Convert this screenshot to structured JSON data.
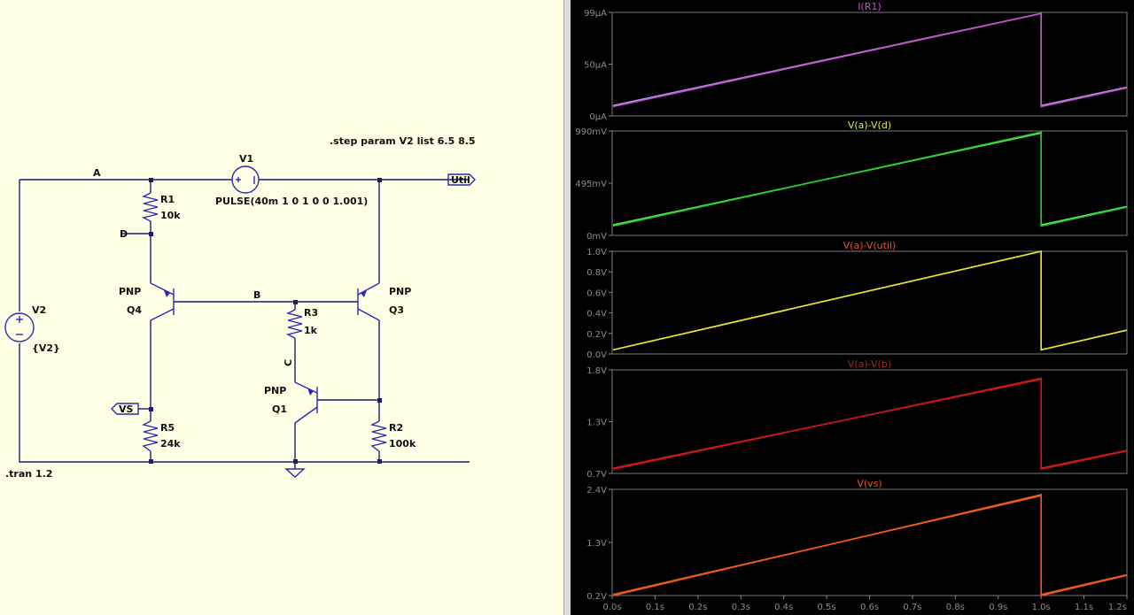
{
  "schematic": {
    "step_directive": ".step param V2 list 6.5 8.5",
    "tran_directive": ".tran 1.2",
    "nodes": {
      "a": "A",
      "b": "B",
      "c": "C",
      "d": "D"
    },
    "v1": {
      "name": "V1",
      "value": "PULSE(40m 1 0 1 0 0 1.001)"
    },
    "v2": {
      "name": "V2",
      "value": "{V2}"
    },
    "r1": {
      "name": "R1",
      "value": "10k"
    },
    "r2": {
      "name": "R2",
      "value": "100k"
    },
    "r3": {
      "name": "R3",
      "value": "1k"
    },
    "r5": {
      "name": "R5",
      "value": "24k"
    },
    "q1": {
      "name": "Q1",
      "model": "PNP"
    },
    "q3": {
      "name": "Q3",
      "model": "PNP"
    },
    "q4": {
      "name": "Q4",
      "model": "PNP"
    },
    "port_util": "Util",
    "port_vs": "VS"
  },
  "waveforms": {
    "x_ticks": [
      "0.0s",
      "0.1s",
      "0.2s",
      "0.3s",
      "0.4s",
      "0.5s",
      "0.6s",
      "0.7s",
      "0.8s",
      "0.9s",
      "1.0s",
      "1.1s",
      "1.2s"
    ],
    "panes": [
      {
        "title": "I(R1)",
        "color": "#d14bd1",
        "trace_colors": [
          "#d14bd1",
          "#a0a0e8"
        ],
        "y_ticks": [
          "99µA",
          "50µA",
          "0µA"
        ],
        "start": [
          0.09,
          0.1
        ],
        "peak": [
          0.99,
          0.99
        ],
        "restart": [
          0.09,
          0.1
        ],
        "ylim": [
          0,
          1
        ]
      },
      {
        "title": "V(a)-V(d)",
        "color": "#e8e840",
        "trace_colors": [
          "#22cc22",
          "#66ee66"
        ],
        "y_ticks": [
          "990mV",
          "495mV",
          "0mV"
        ],
        "start": [
          0.09,
          0.1
        ],
        "peak": [
          0.99,
          0.98
        ],
        "restart": [
          0.09,
          0.1
        ],
        "ylim": [
          0,
          1
        ]
      },
      {
        "title": "V(a)-V(util)",
        "color": "#e8541c",
        "trace_colors": [
          "#e8e030",
          "#e8e030"
        ],
        "y_ticks": [
          "1.0V",
          "0.8V",
          "0.6V",
          "0.4V",
          "0.2V",
          "0.0V"
        ],
        "start": [
          0.04,
          0.04
        ],
        "peak": [
          1.0,
          1.0
        ],
        "restart": [
          0.04,
          0.04
        ],
        "ylim": [
          0,
          1
        ]
      },
      {
        "title": "V(a)-V(b)",
        "color": "#9b2b20",
        "trace_colors": [
          "#c41616",
          "#d02020"
        ],
        "y_ticks": [
          "1.8V",
          "1.3V",
          "0.7V"
        ],
        "start": [
          0.04,
          0.05
        ],
        "peak": [
          0.92,
          0.91
        ],
        "restart": [
          0.04,
          0.05
        ],
        "ylim": [
          0,
          1
        ]
      },
      {
        "title": "V(vs)",
        "color": "#e8541c",
        "trace_colors": [
          "#f05a14",
          "#e06020"
        ],
        "y_ticks": [
          "2.4V",
          "1.3V",
          "0.2V"
        ],
        "start": [
          0.0,
          0.01
        ],
        "peak": [
          0.95,
          0.94
        ],
        "restart": [
          0.0,
          0.01
        ],
        "ylim": [
          0,
          1
        ]
      }
    ]
  }
}
